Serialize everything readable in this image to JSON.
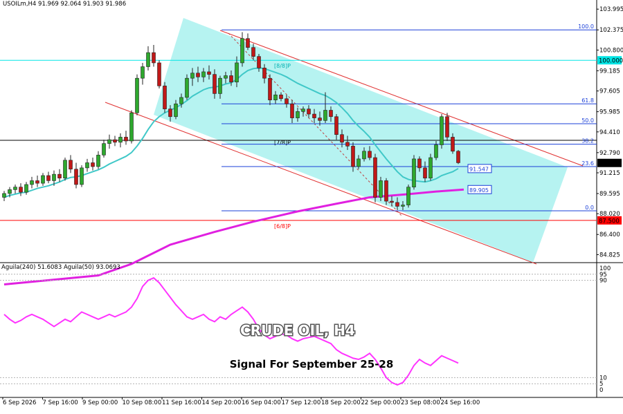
{
  "header": {
    "text": "USOILm,H4  91.969 92.064 91.903 91.986"
  },
  "indicator_header": {
    "text": "Aguila(240) 51.6083  Aguila(50) 93.0693"
  },
  "overlay": {
    "title": "CRUDE OIL, H4",
    "subtitle": "Signal For September 25-28"
  },
  "chart_data": [
    {
      "type": "candlestick",
      "symbol": "USOILm",
      "timeframe": "H4",
      "ohlc_last": {
        "open": 91.969,
        "high": 92.064,
        "low": 91.903,
        "close": 91.986
      },
      "ylim": [
        84.2,
        104.6
      ],
      "y_ticks": [
        "103.995",
        "102.375",
        "100.800",
        "99.185",
        "97.605",
        "95.985",
        "94.410",
        "92.790",
        "91.215",
        "89.595",
        "88.020",
        "86.400",
        "84.825"
      ],
      "x_tick_labels": [
        "6 Sep 2026",
        "7 Sep 16:00",
        "9 Sep 00:00",
        "10 Sep 08:00",
        "11 Sep 16:00",
        "14 Sep 20:00",
        "16 Sep 04:00",
        "17 Sep 12:00",
        "18 Sep 20:00",
        "22 Sep 00:00",
        "23 Sep 08:00",
        "24 Sep 16:00"
      ],
      "candles": [
        [
          89.3,
          89.8,
          89.0,
          89.6
        ],
        [
          89.6,
          90.1,
          89.3,
          89.9
        ],
        [
          89.9,
          90.3,
          89.6,
          90.1
        ],
        [
          90.1,
          90.4,
          89.4,
          89.7
        ],
        [
          89.7,
          90.5,
          89.5,
          90.3
        ],
        [
          90.3,
          90.9,
          90.0,
          90.6
        ],
        [
          90.6,
          91.0,
          90.1,
          90.4
        ],
        [
          90.4,
          91.2,
          90.2,
          91.0
        ],
        [
          91.0,
          91.3,
          90.4,
          90.6
        ],
        [
          90.6,
          91.4,
          90.2,
          91.1
        ],
        [
          91.1,
          91.5,
          90.5,
          90.8
        ],
        [
          90.8,
          92.4,
          90.6,
          92.2
        ],
        [
          92.2,
          92.6,
          91.2,
          91.5
        ],
        [
          91.5,
          92.0,
          90.0,
          90.3
        ],
        [
          90.3,
          91.8,
          90.1,
          91.6
        ],
        [
          91.6,
          92.3,
          91.3,
          92.0
        ],
        [
          92.0,
          92.4,
          91.4,
          91.7
        ],
        [
          91.7,
          92.9,
          91.5,
          92.6
        ],
        [
          92.6,
          93.8,
          92.4,
          93.5
        ],
        [
          93.5,
          94.2,
          93.1,
          93.8
        ],
        [
          93.8,
          94.1,
          93.3,
          93.6
        ],
        [
          93.6,
          94.3,
          93.2,
          94.0
        ],
        [
          94.0,
          94.5,
          93.4,
          93.7
        ],
        [
          93.7,
          96.1,
          93.5,
          95.9
        ],
        [
          95.9,
          98.9,
          95.7,
          98.6
        ],
        [
          98.6,
          99.8,
          98.1,
          99.5
        ],
        [
          99.5,
          101.1,
          99.2,
          100.6
        ],
        [
          100.6,
          101.2,
          99.5,
          99.8
        ],
        [
          99.8,
          100.0,
          97.8,
          98.0
        ],
        [
          98.0,
          98.3,
          95.9,
          96.2
        ],
        [
          96.2,
          96.5,
          95.2,
          95.6
        ],
        [
          95.6,
          96.9,
          95.4,
          96.6
        ],
        [
          96.6,
          97.4,
          96.3,
          97.1
        ],
        [
          97.1,
          98.9,
          96.9,
          98.6
        ],
        [
          98.6,
          99.4,
          98.0,
          99.0
        ],
        [
          99.0,
          99.5,
          98.3,
          98.7
        ],
        [
          98.7,
          99.4,
          98.3,
          99.1
        ],
        [
          99.1,
          99.6,
          98.5,
          98.9
        ],
        [
          98.9,
          99.3,
          97.0,
          97.4
        ],
        [
          97.4,
          98.8,
          97.0,
          98.6
        ],
        [
          98.6,
          99.1,
          98.2,
          98.8
        ],
        [
          98.8,
          99.2,
          98.0,
          98.3
        ],
        [
          98.3,
          100.3,
          97.9,
          99.8
        ],
        [
          99.8,
          102.2,
          99.5,
          101.7
        ],
        [
          101.7,
          102.1,
          100.8,
          101.0
        ],
        [
          101.0,
          101.3,
          100.0,
          100.3
        ],
        [
          100.3,
          100.5,
          99.1,
          99.4
        ],
        [
          99.4,
          99.7,
          98.2,
          98.6
        ],
        [
          98.6,
          98.9,
          96.5,
          96.9
        ],
        [
          96.9,
          97.6,
          96.6,
          97.3
        ],
        [
          97.3,
          97.5,
          96.8,
          97.0
        ],
        [
          97.0,
          97.3,
          96.3,
          96.6
        ],
        [
          96.6,
          96.9,
          95.1,
          95.5
        ],
        [
          95.5,
          96.3,
          95.2,
          96.0
        ],
        [
          96.0,
          96.4,
          95.6,
          96.2
        ],
        [
          96.2,
          96.5,
          95.5,
          95.8
        ],
        [
          95.8,
          96.2,
          95.1,
          95.5
        ],
        [
          95.5,
          96.0,
          94.9,
          95.3
        ],
        [
          95.3,
          97.5,
          95.1,
          96.1
        ],
        [
          96.1,
          96.4,
          95.2,
          95.6
        ],
        [
          95.6,
          95.8,
          93.8,
          94.2
        ],
        [
          94.2,
          94.6,
          93.2,
          93.6
        ],
        [
          93.6,
          94.1,
          93.0,
          93.3
        ],
        [
          93.3,
          93.6,
          91.3,
          91.7
        ],
        [
          91.7,
          92.6,
          91.5,
          92.3
        ],
        [
          92.3,
          93.2,
          92.1,
          92.9
        ],
        [
          92.9,
          93.3,
          92.2,
          92.4
        ],
        [
          92.4,
          92.7,
          88.9,
          89.3
        ],
        [
          89.3,
          90.9,
          89.0,
          90.6
        ],
        [
          90.6,
          90.8,
          88.7,
          89.0
        ],
        [
          89.0,
          89.4,
          88.6,
          88.9
        ],
        [
          88.9,
          89.3,
          88.3,
          88.6
        ],
        [
          88.6,
          89.0,
          88.3,
          88.7
        ],
        [
          88.7,
          90.3,
          88.5,
          90.1
        ],
        [
          90.1,
          92.6,
          89.9,
          92.3
        ],
        [
          92.3,
          92.5,
          91.3,
          91.6
        ],
        [
          91.6,
          92.1,
          90.5,
          90.8
        ],
        [
          90.8,
          92.7,
          90.6,
          92.4
        ],
        [
          92.4,
          93.7,
          92.2,
          93.4
        ],
        [
          93.4,
          95.8,
          93.1,
          95.6
        ],
        [
          95.6,
          95.9,
          93.7,
          94.0
        ],
        [
          94.0,
          94.3,
          92.7,
          92.9
        ],
        [
          92.9,
          93.0,
          91.9,
          92.0
        ]
      ],
      "moving_average": {
        "name": "",
        "color": "#40c8c8",
        "values": [
          89.3,
          89.45,
          89.55,
          89.65,
          89.7,
          89.85,
          90.0,
          90.1,
          90.2,
          90.35,
          90.5,
          90.7,
          90.85,
          90.9,
          91.0,
          91.15,
          91.3,
          91.45,
          91.65,
          91.9,
          92.1,
          92.3,
          92.5,
          92.8,
          93.3,
          93.9,
          94.6,
          95.2,
          95.6,
          95.9,
          96.1,
          96.3,
          96.55,
          96.85,
          97.2,
          97.45,
          97.7,
          97.85,
          97.9,
          98.0,
          98.15,
          98.25,
          98.5,
          98.9,
          99.2,
          99.35,
          99.4,
          99.35,
          99.2,
          99.05,
          98.9,
          98.7,
          98.45,
          98.2,
          98.0,
          97.8,
          97.6,
          97.4,
          97.25,
          97.0,
          96.7,
          96.3,
          95.85,
          95.3,
          94.85,
          94.45,
          94.0,
          93.4,
          92.85,
          92.3,
          91.8,
          91.3,
          90.9,
          90.7,
          90.6,
          90.55,
          90.5,
          90.6,
          90.75,
          91.0,
          91.15,
          91.3,
          91.55
        ]
      },
      "long_ma": {
        "name": "",
        "color": "#e020e0",
        "values": [
          [
            0,
            82.5
          ],
          [
            17,
            83.2
          ],
          [
            23,
            84.1
          ],
          [
            30,
            85.6
          ],
          [
            38,
            86.6
          ],
          [
            45,
            87.4
          ],
          [
            53,
            88.2
          ],
          [
            60,
            88.8
          ],
          [
            66,
            89.3
          ],
          [
            73,
            89.55
          ],
          [
            78,
            89.75
          ],
          [
            83,
            89.905
          ]
        ]
      },
      "price_labels": [
        {
          "text": "100.000",
          "value": 100.0,
          "color": "#00e5e5",
          "text_color": "#ffffff"
        },
        {
          "text": "91.986",
          "value": 91.986,
          "color": "#000000",
          "text_color": "#ffffff"
        },
        {
          "text": "87.500",
          "value": 87.5,
          "color": "#ff0000",
          "text_color": "#ffffff"
        }
      ],
      "fib_levels": [
        {
          "label": "100.0",
          "value": 102.375
        },
        {
          "label": "61.8",
          "value": 96.6
        },
        {
          "label": "50.0",
          "value": 95.05
        },
        {
          "label": "38.2",
          "value": 93.45
        },
        {
          "label": "23.6",
          "value": 91.7
        },
        {
          "label": "0.0",
          "value": 88.25
        }
      ],
      "murray_levels": [
        {
          "label": "[8/8]P",
          "value": 100.0,
          "color": "#00e5e5"
        },
        {
          "label": "[7/8]P",
          "value": 93.75,
          "color": "#000000"
        },
        {
          "label": "[6/8]P",
          "value": 87.5,
          "color": "#ff0000"
        }
      ],
      "annotations": [
        {
          "text": "91.547",
          "value": 91.547,
          "color": "#1a3fd8"
        },
        {
          "text": "89.905",
          "value": 89.905,
          "color": "#1a3fd8"
        }
      ]
    },
    {
      "type": "line",
      "name": "Aguila oscillator",
      "ylim": [
        0,
        100
      ],
      "y_ticks": [
        "100",
        "95",
        "90",
        "10",
        "5",
        "0"
      ],
      "values": [
        62,
        58,
        55,
        57,
        60,
        62,
        60,
        58,
        55,
        52,
        55,
        58,
        56,
        60,
        64,
        62,
        60,
        58,
        60,
        62,
        60,
        62,
        64,
        68,
        75,
        85,
        90,
        92,
        88,
        82,
        76,
        70,
        65,
        60,
        58,
        60,
        62,
        58,
        56,
        60,
        58,
        62,
        65,
        68,
        64,
        58,
        50,
        45,
        42,
        44,
        46,
        45,
        42,
        40,
        42,
        43,
        44,
        42,
        40,
        38,
        33,
        30,
        28,
        26,
        25,
        27,
        30,
        25,
        18,
        10,
        6,
        4,
        6,
        12,
        20,
        25,
        22,
        20,
        24,
        28,
        26,
        24,
        22
      ]
    }
  ]
}
